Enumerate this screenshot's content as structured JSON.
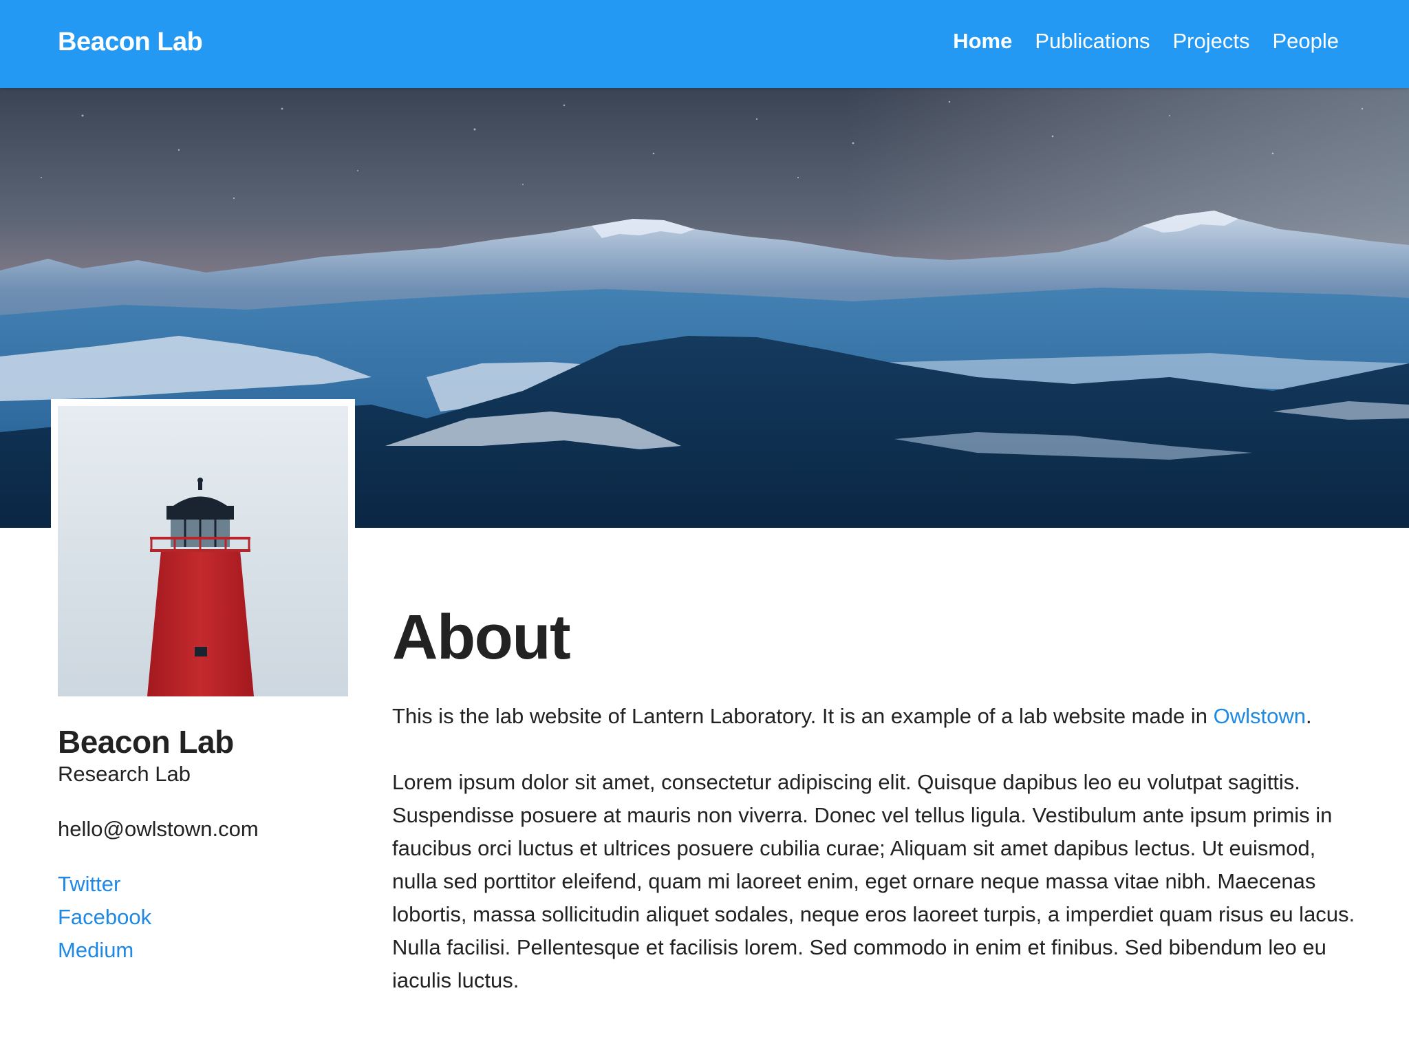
{
  "nav": {
    "brand": "Beacon Lab",
    "links": [
      {
        "label": "Home",
        "active": true
      },
      {
        "label": "Publications",
        "active": false
      },
      {
        "label": "Projects",
        "active": false
      },
      {
        "label": "People",
        "active": false
      }
    ]
  },
  "profile": {
    "name": "Beacon Lab",
    "role": "Research Lab",
    "email": "hello@owlstown.com",
    "social_links": [
      "Twitter",
      "Facebook",
      "Medium"
    ]
  },
  "main": {
    "title": "About",
    "intro_before_link": "This is the lab website of Lantern Laboratory. It is an example of a lab website made in ",
    "intro_link": "Owlstown",
    "intro_after_link": ".",
    "body": "Lorem ipsum dolor sit amet, consectetur adipiscing elit. Quisque dapibus leo eu volutpat sagittis. Suspendisse posuere at mauris non viverra. Donec vel tellus ligula. Vestibulum ante ipsum primis in faucibus orci luctus et ultrices posuere cubilia curae; Aliquam sit amet dapibus lectus. Ut euismod, nulla sed porttitor eleifend, quam mi laoreet enim, eget ornare neque massa vitae nibh. Maecenas lobortis, massa sollicitudin aliquet sodales, neque eros laoreet turpis, a imperdiet quam risus eu lacus. Nulla facilisi. Pellentesque et facilisis lorem. Sed commodo in enim et finibus. Sed bibendum leo eu iaculis luctus."
  },
  "colors": {
    "navbar": "#2399f4",
    "link": "#1e88e5",
    "text": "#222222"
  },
  "images": {
    "hero": "mountain-landscape-at-dusk",
    "profile_photo": "red-lighthouse"
  }
}
